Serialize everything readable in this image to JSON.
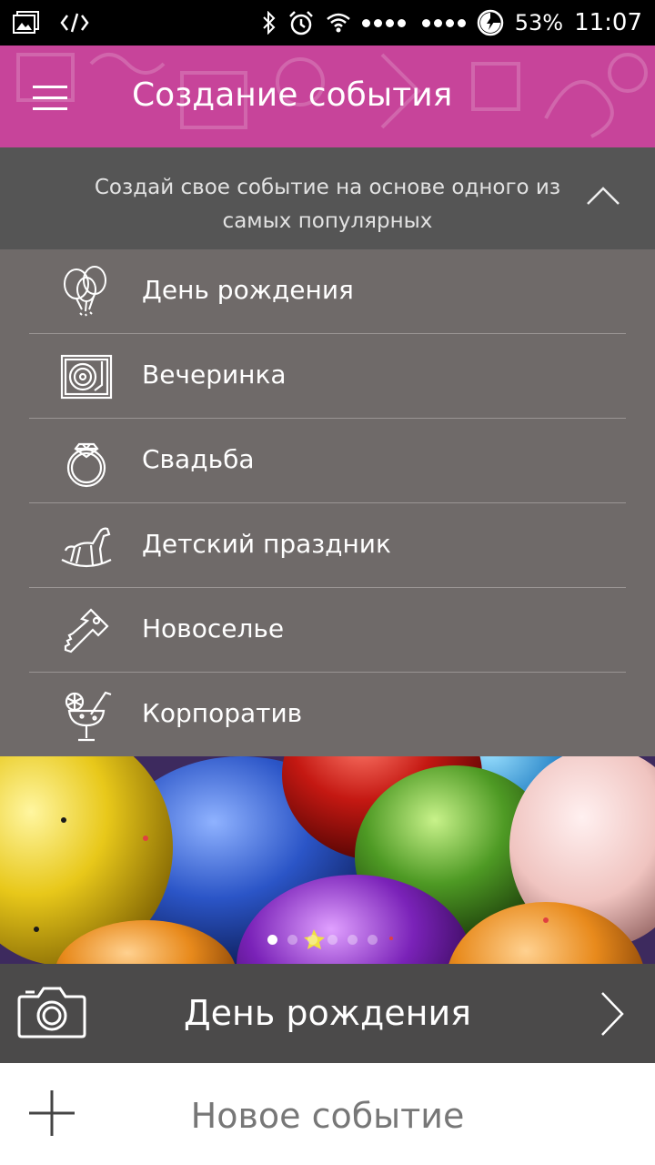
{
  "status_bar": {
    "battery": "53%",
    "time": "11:07"
  },
  "app_bar": {
    "title": "Создание события"
  },
  "subheader": {
    "text": "Создай свое событие на основе одного из самых популярных"
  },
  "categories": [
    {
      "label": "День рождения",
      "icon": "balloons-icon"
    },
    {
      "label": "Вечеринка",
      "icon": "turntable-icon"
    },
    {
      "label": "Свадьба",
      "icon": "ring-icon"
    },
    {
      "label": "Детский праздник",
      "icon": "rocking-horse-icon"
    },
    {
      "label": "Новоселье",
      "icon": "key-icon"
    },
    {
      "label": "Корпоратив",
      "icon": "cocktail-icon"
    }
  ],
  "banner": {
    "pages": 6,
    "active_page": 1
  },
  "selected_event": {
    "label": "День рождения"
  },
  "new_event": {
    "label": "Новое событие"
  },
  "colors": {
    "app_bar": "#c7449a",
    "subheader": "#555555",
    "list_bg": "#6f6a69",
    "selected_bar": "#4b4a4a"
  }
}
